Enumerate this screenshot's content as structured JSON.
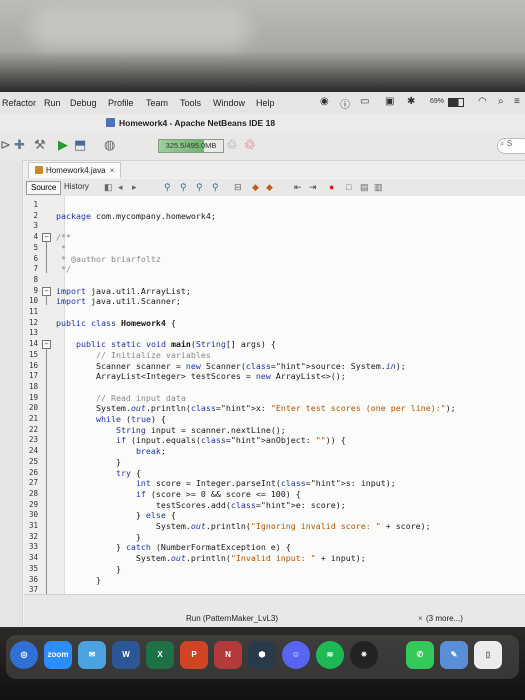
{
  "menubar": {
    "items": [
      "Refactor",
      "Run",
      "Debug",
      "Profile",
      "Team",
      "Tools",
      "Window",
      "Help"
    ],
    "battery": "69%"
  },
  "window": {
    "title": "Homework4 - Apache NetBeans IDE 18"
  },
  "toolbar": {
    "memory": "325.5/495.0MB"
  },
  "editor_tab": {
    "label": "Homework4.java",
    "close": "×"
  },
  "source_bar": {
    "source": "Source",
    "history": "History"
  },
  "code": {
    "lines": [
      {
        "n": "1",
        "t": ""
      },
      {
        "n": "2",
        "t": "package com.mycompany.homework4;"
      },
      {
        "n": "3",
        "t": ""
      },
      {
        "n": "4",
        "t": "/**"
      },
      {
        "n": "5",
        "t": " *"
      },
      {
        "n": "6",
        "t": " * @author briarfoltz"
      },
      {
        "n": "7",
        "t": " */"
      },
      {
        "n": "8",
        "t": ""
      },
      {
        "n": "9",
        "t": "import java.util.ArrayList;"
      },
      {
        "n": "10",
        "t": "import java.util.Scanner;"
      },
      {
        "n": "11",
        "t": ""
      },
      {
        "n": "12",
        "t": "public class Homework4 {"
      },
      {
        "n": "13",
        "t": ""
      },
      {
        "n": "14",
        "t": "    public static void main(String[] args) {"
      },
      {
        "n": "15",
        "t": "        // Initialize variables"
      },
      {
        "n": "16",
        "t": "        Scanner scanner = new Scanner(source: System.in);"
      },
      {
        "n": "17",
        "t": "        ArrayList<Integer> testScores = new ArrayList<>();"
      },
      {
        "n": "18",
        "t": ""
      },
      {
        "n": "19",
        "t": "        // Read input data"
      },
      {
        "n": "20",
        "t": "        System.out.println(x: \"Enter test scores (one per line):\");"
      },
      {
        "n": "21",
        "t": "        while (true) {"
      },
      {
        "n": "22",
        "t": "            String input = scanner.nextLine();"
      },
      {
        "n": "23",
        "t": "            if (input.equals(anObject: \"\")) {"
      },
      {
        "n": "24",
        "t": "                break;"
      },
      {
        "n": "25",
        "t": "            }"
      },
      {
        "n": "26",
        "t": "            try {"
      },
      {
        "n": "27",
        "t": "                int score = Integer.parseInt(s: input);"
      },
      {
        "n": "28",
        "t": "                if (score >= 0 && score <= 100) {"
      },
      {
        "n": "29",
        "t": "                    testScores.add(e: score);"
      },
      {
        "n": "30",
        "t": "                } else {"
      },
      {
        "n": "31",
        "t": "                    System.out.println(\"Ignoring invalid score: \" + score);"
      },
      {
        "n": "32",
        "t": "                }"
      },
      {
        "n": "33",
        "t": "            } catch (NumberFormatException e) {"
      },
      {
        "n": "34",
        "t": "                System.out.println(\"Invalid input: \" + input);"
      },
      {
        "n": "35",
        "t": "            }"
      },
      {
        "n": "36",
        "t": "        }"
      },
      {
        "n": "37",
        "t": ""
      }
    ]
  },
  "output": {
    "run": "Run (PatternMaker_LvL3)",
    "more": "(3 more...)",
    "close": "×"
  },
  "dock": {
    "zoom": "zoom"
  }
}
